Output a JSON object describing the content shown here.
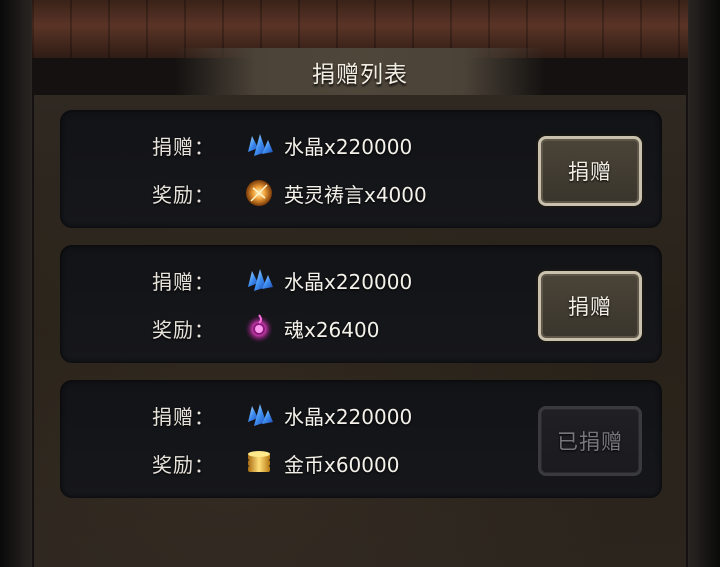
{
  "title": "捐赠列表",
  "rows": [
    {
      "donate_label": "捐赠：",
      "donate_icon": "crystal-icon",
      "donate_value": "水晶x220000",
      "reward_label": "奖励：",
      "reward_icon": "spirit-scroll-icon",
      "reward_value": "英灵祷言x4000",
      "button_label": "捐赠",
      "button_state": "active"
    },
    {
      "donate_label": "捐赠：",
      "donate_icon": "crystal-icon",
      "donate_value": "水晶x220000",
      "reward_label": "奖励：",
      "reward_icon": "soul-orb-icon",
      "reward_value": "魂x26400",
      "button_label": "捐赠",
      "button_state": "active"
    },
    {
      "donate_label": "捐赠：",
      "donate_icon": "crystal-icon",
      "donate_value": "水晶x220000",
      "reward_label": "奖励：",
      "reward_icon": "gold-coins-icon",
      "reward_value": "金币x60000",
      "button_label": "已捐赠",
      "button_state": "disabled"
    }
  ],
  "colors": {
    "crystal": "#3f8ff0",
    "spirit": "#f2a23a",
    "soul": "#e040c0",
    "gold": "#f0c030"
  }
}
